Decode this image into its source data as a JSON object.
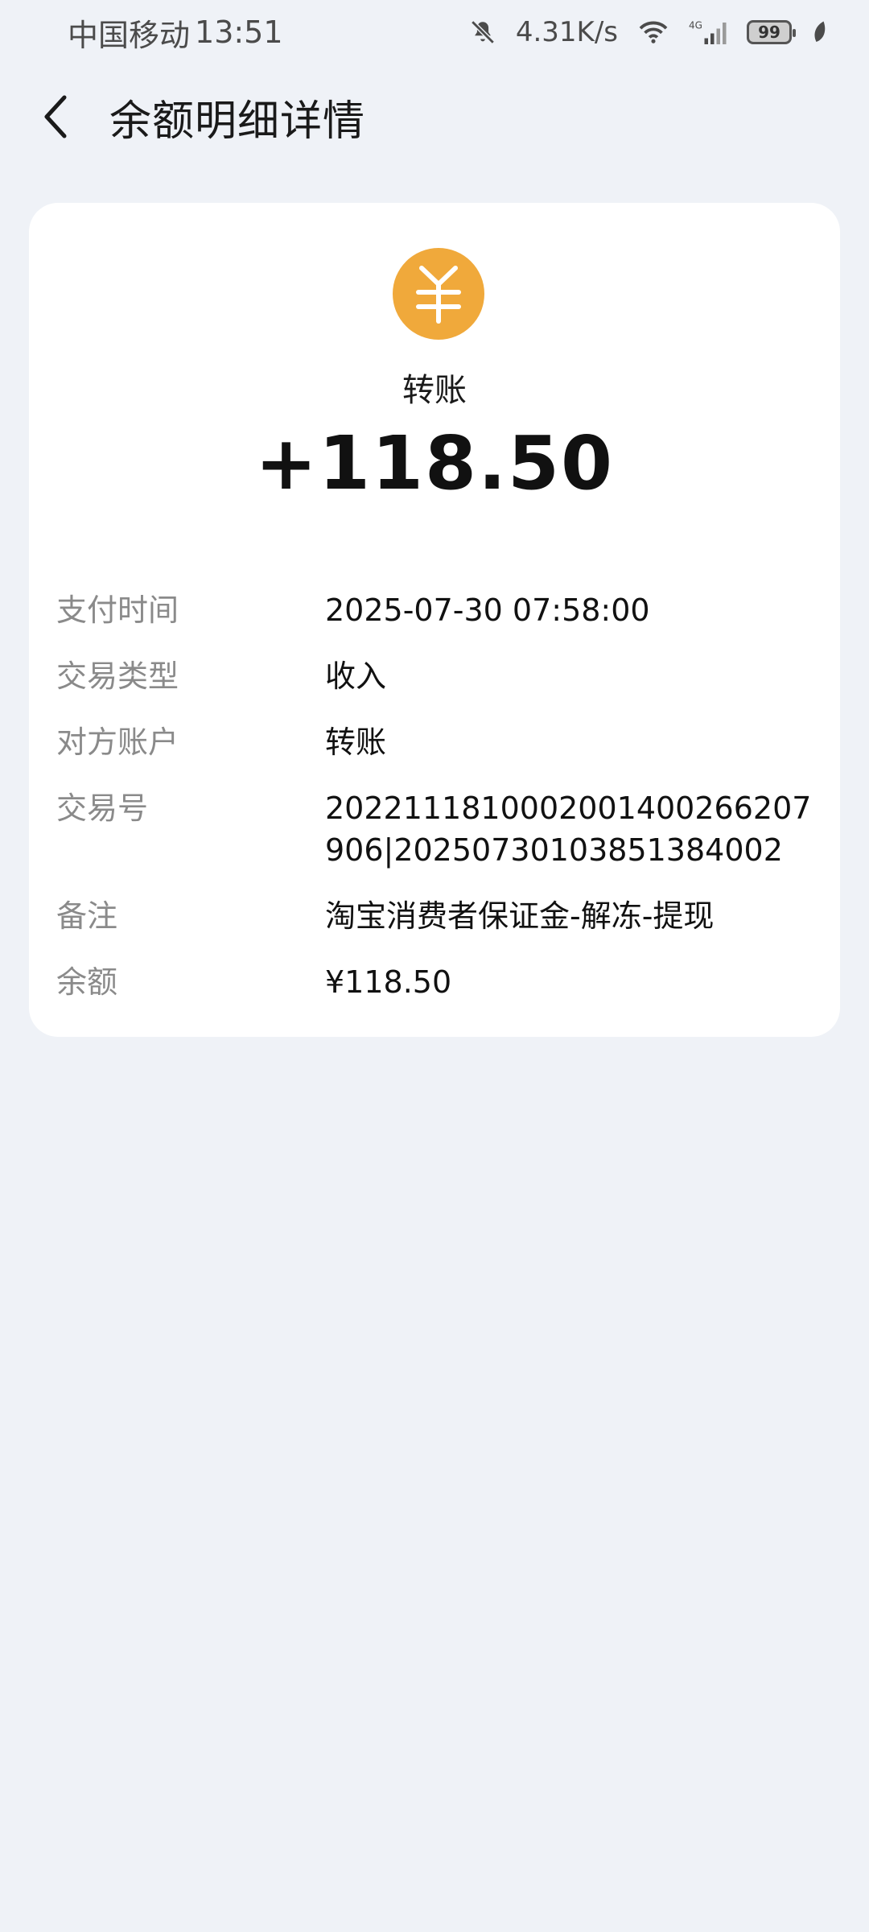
{
  "status_bar": {
    "carrier": "中国移动",
    "time": "13:51",
    "net_speed": "4.31K/s",
    "battery": "99",
    "icons": [
      "mute-bell-icon",
      "wifi-icon",
      "signal-4g-icon",
      "battery-icon",
      "leaf-icon"
    ]
  },
  "header": {
    "title": "余额明细详情",
    "back_icon": "chevron-left-icon"
  },
  "card": {
    "icon": "yuan-coin-icon",
    "icon_color": "#f0a93b",
    "tx_type": "转账",
    "amount": "+118.50",
    "details": [
      {
        "label": "支付时间",
        "value": "2025-07-30 07:58:00"
      },
      {
        "label": "交易类型",
        "value": "收入"
      },
      {
        "label": "对方账户",
        "value": "转账"
      },
      {
        "label": "交易号",
        "value": "2022111810002001400266207906|20250730103851384002"
      },
      {
        "label": "备注",
        "value": "淘宝消费者保证金-解冻-提现"
      },
      {
        "label": "余额",
        "value": "¥118.50"
      }
    ]
  }
}
